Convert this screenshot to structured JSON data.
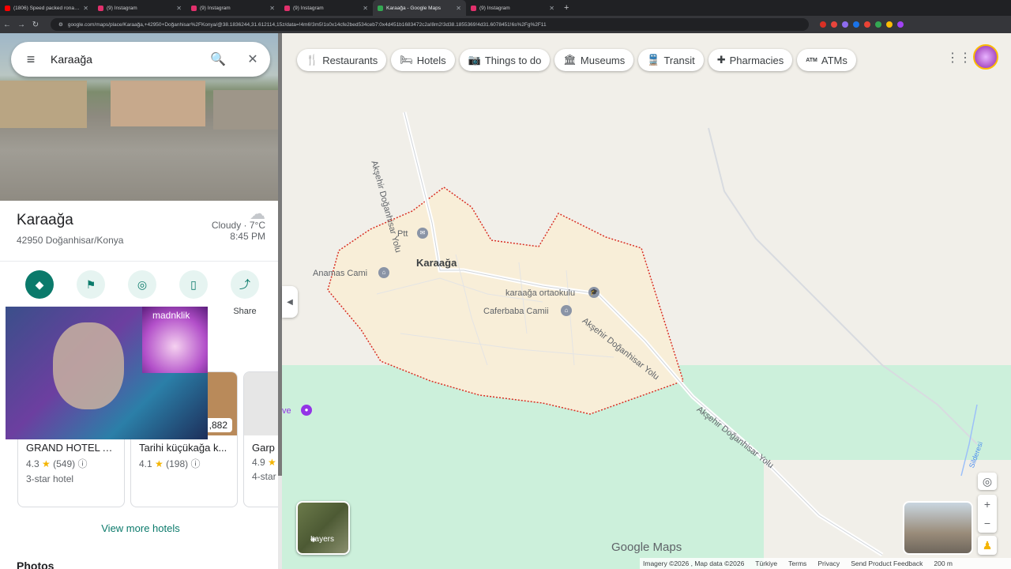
{
  "browser": {
    "tabs": [
      {
        "title": "(1806) Speed packed ronaldo o",
        "color": "#ff0000"
      },
      {
        "title": "(9) Instagram",
        "color": "#e1306c"
      },
      {
        "title": "(9) Instagram",
        "color": "#e1306c"
      },
      {
        "title": "(9) Instagram",
        "color": "#e1306c"
      },
      {
        "title": "Karaağa - Google Maps",
        "color": "#34a853"
      },
      {
        "title": "(9) Instagram",
        "color": "#e1306c"
      }
    ],
    "new_tab": "+",
    "url": "google.com/maps/place/Karaağa,+42950+Doğanhisar%2FKonya/@38.1836244,31.612114,15z/data=!4m6!3m5!1s0x14cfe2bed534ceb7:0x4d451b1683472c2a!8m2!3d38.1855369!4d31.6078451!6s%2Fg%2F11"
  },
  "search": {
    "query": "Karaağa",
    "menu_icon": "≡",
    "search_icon": "🔍",
    "close_icon": "✕"
  },
  "place": {
    "name": "Karaağa",
    "address": "42950 Doğanhisar/Konya",
    "weather": "Cloudy · 7°C",
    "time": "8:45 PM"
  },
  "actions": [
    {
      "label": "",
      "icon": "◆"
    },
    {
      "label": "",
      "icon": "⚑"
    },
    {
      "label": "",
      "icon": "◎"
    },
    {
      "label": "",
      "icon": "▯"
    },
    {
      "label": "Share",
      "icon": "⤴"
    }
  ],
  "hotels": [
    {
      "name": "GRAND HOTEL A...",
      "rating": "4.3",
      "reviews": "(549)",
      "class": "3-star hotel",
      "price": ""
    },
    {
      "name": "Tarihi küçükağa k...",
      "rating": "4.1",
      "reviews": "(198)",
      "class": "",
      "price": ",882"
    },
    {
      "name": "Garp",
      "rating": "4.9",
      "reviews": "",
      "class": "4-star",
      "price": ""
    }
  ],
  "view_more": "View more hotels",
  "photos_heading": "Photos",
  "webcam_tag": "madnklik",
  "chips": [
    {
      "label": "Restaurants",
      "icon": "🍴"
    },
    {
      "label": "Hotels",
      "icon": "🛏"
    },
    {
      "label": "Things to do",
      "icon": "📷"
    },
    {
      "label": "Museums",
      "icon": "🏛"
    },
    {
      "label": "Transit",
      "icon": "🚆"
    },
    {
      "label": "Pharmacies",
      "icon": "✚"
    },
    {
      "label": "ATMs",
      "icon": "ATM"
    }
  ],
  "map_labels": {
    "town": "Karaağa",
    "ptt": "Ptt",
    "anamas": "Anamas Cami",
    "school": "karaağa ortaokulu",
    "mosque": "Caferbaba Camii",
    "road1": "Akşehir Doğanhisar Yolu",
    "road2": "Akşehir Doğanhisar Yolu",
    "road3": "Akşehir Doğanhisar Yolu",
    "partial": "ve",
    "stream": "Silderesi"
  },
  "layers_label": "Layers",
  "logo": "Google Maps",
  "footer": {
    "imagery": "Imagery ©2026 , Map data ©2026",
    "country": "Türkiye",
    "terms": "Terms",
    "privacy": "Privacy",
    "feedback": "Send Product Feedback",
    "scale": "200 m"
  },
  "colors": {
    "accent": "#0b7a6b",
    "boundary": "#d93025"
  }
}
